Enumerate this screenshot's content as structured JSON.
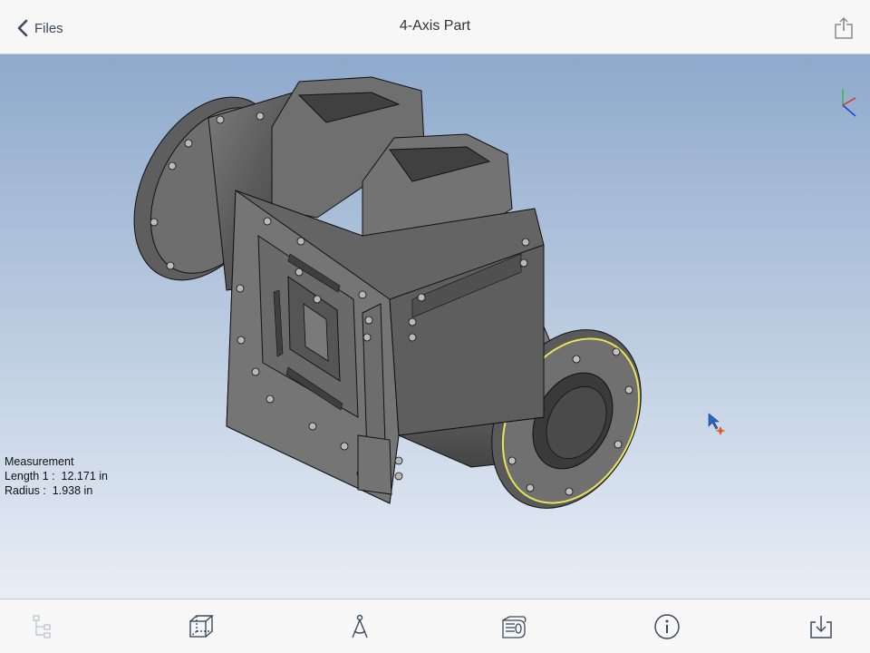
{
  "nav": {
    "back_label": "Files",
    "title": "4-Axis Part"
  },
  "measurement": {
    "heading": "Measurement",
    "length_line": "Length 1 :  12.171 in",
    "radius_line": "Radius :  1.938 in"
  },
  "toolbar": {
    "items": [
      {
        "icon": "tree-icon",
        "enabled": false
      },
      {
        "icon": "cube-view-icon",
        "enabled": true
      },
      {
        "icon": "measure-compass-icon",
        "enabled": true
      },
      {
        "icon": "section-cut-icon",
        "enabled": true
      },
      {
        "icon": "info-icon",
        "enabled": true
      },
      {
        "icon": "download-icon",
        "enabled": true
      }
    ]
  },
  "colors": {
    "accent": "#3b4a5e",
    "viewport_top": "#8fa9cc",
    "viewport_bottom": "#e8eef6",
    "part_gray": "#6b6b6b",
    "highlight_edge": "#e9e25a"
  }
}
